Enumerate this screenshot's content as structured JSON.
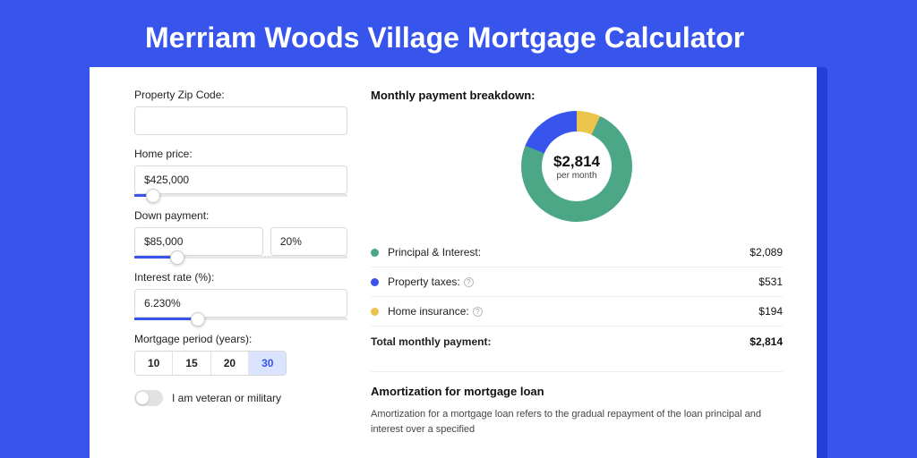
{
  "page_title": "Merriam Woods Village Mortgage Calculator",
  "colors": {
    "principal_interest": "#4BA786",
    "property_taxes": "#3754ED",
    "home_insurance": "#EBC44B"
  },
  "left": {
    "zip_label": "Property Zip Code:",
    "zip_value": "",
    "home_price_label": "Home price:",
    "home_price_value": "$425,000",
    "home_price_slider_pct": 9,
    "down_payment_label": "Down payment:",
    "down_payment_value": "$85,000",
    "down_payment_pct_value": "20%",
    "down_payment_slider_pct": 20,
    "interest_label": "Interest rate (%):",
    "interest_value": "6.230%",
    "interest_slider_pct": 30,
    "period_label": "Mortgage period (years):",
    "period_options": [
      "10",
      "15",
      "20",
      "30"
    ],
    "period_active_index": 3,
    "veteran_label": "I am veteran or military"
  },
  "right": {
    "breakdown_heading": "Monthly payment breakdown:",
    "donut_amount": "$2,814",
    "donut_sub": "per month",
    "legend": [
      {
        "label": "Principal & Interest:",
        "value": "$2,089",
        "color_key": "principal_interest",
        "info": false
      },
      {
        "label": "Property taxes:",
        "value": "$531",
        "color_key": "property_taxes",
        "info": true
      },
      {
        "label": "Home insurance:",
        "value": "$194",
        "color_key": "home_insurance",
        "info": true
      }
    ],
    "total_label": "Total monthly payment:",
    "total_value": "$2,814",
    "amort_heading": "Amortization for mortgage loan",
    "amort_text": "Amortization for a mortgage loan refers to the gradual repayment of the loan principal and interest over a specified"
  }
}
